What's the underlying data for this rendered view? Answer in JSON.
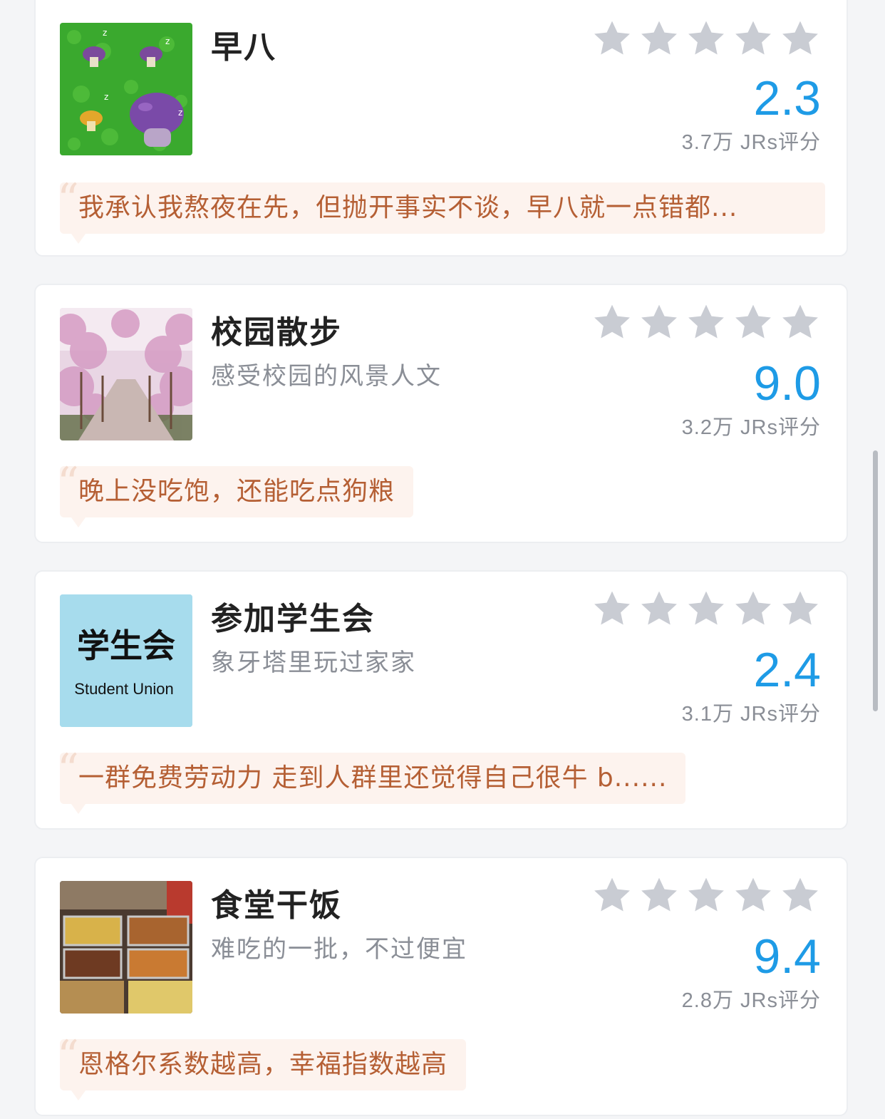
{
  "items": [
    {
      "title": "早八",
      "subtitle": "",
      "score": "2.3",
      "rating_count": "3.7万 JRs评分",
      "quote": "我承认我熬夜在先，但抛开事实不谈，早八就一点错都...",
      "thumbnail": "sleeping-mushrooms"
    },
    {
      "title": "校园散步",
      "subtitle": "感受校园的风景人文",
      "score": "9.0",
      "rating_count": "3.2万 JRs评分",
      "quote": "晚上没吃饱，还能吃点狗粮",
      "thumbnail": "cherry-blossom-path"
    },
    {
      "title": "参加学生会",
      "subtitle": "象牙塔里玩过家家",
      "score": "2.4",
      "rating_count": "3.1万 JRs评分",
      "quote": "一群免费劳动力 走到人群里还觉得自己很牛 b......",
      "thumbnail": "student-union-logo",
      "thumbnail_text_cn": "学生会",
      "thumbnail_text_en": "Student Union"
    },
    {
      "title": "食堂干饭",
      "subtitle": "难吃的一批，不过便宜",
      "score": "9.4",
      "rating_count": "2.8万 JRs评分",
      "quote": "恩格尔系数越高，幸福指数越高",
      "thumbnail": "cafeteria-food"
    }
  ],
  "colors": {
    "score": "#1e9be6",
    "star": "#c9ccd3",
    "quote_bg": "#fdf3ee",
    "quote_text": "#b55f34"
  }
}
